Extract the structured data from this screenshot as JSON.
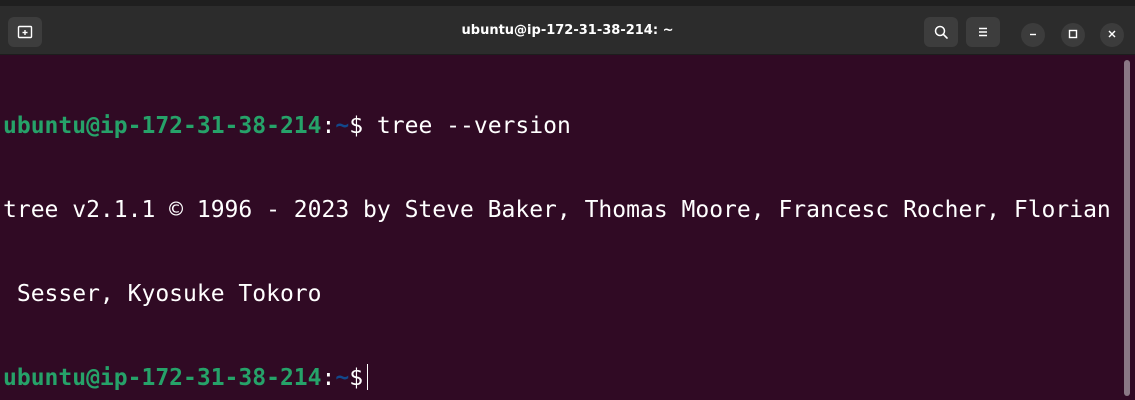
{
  "window": {
    "title": "ubuntu@ip-172-31-38-214: ~"
  },
  "titlebar": {
    "buttons": [
      {
        "name": "new-tab-icon"
      },
      {
        "name": "search-icon"
      },
      {
        "name": "hamburger-menu-icon"
      },
      {
        "name": "minimize-icon"
      },
      {
        "name": "maximize-icon"
      },
      {
        "name": "close-icon"
      }
    ]
  },
  "terminal": {
    "prompt_user_host": "ubuntu@ip-172-31-38-214",
    "prompt_colon": ":",
    "prompt_path": "~",
    "prompt_symbol": "$",
    "command": " tree --version",
    "output_line_1": "tree v2.1.1 © 1996 - 2023 by Steve Baker, Thomas Moore, Francesc Rocher, Florian",
    "output_line_2": " Sesser, Kyosuke Tokoro"
  },
  "colors": {
    "terminal_bg": "#300a24",
    "prompt_user": "#26a269",
    "prompt_path": "#12488b",
    "titlebar_bg": "#2c2c2c"
  }
}
